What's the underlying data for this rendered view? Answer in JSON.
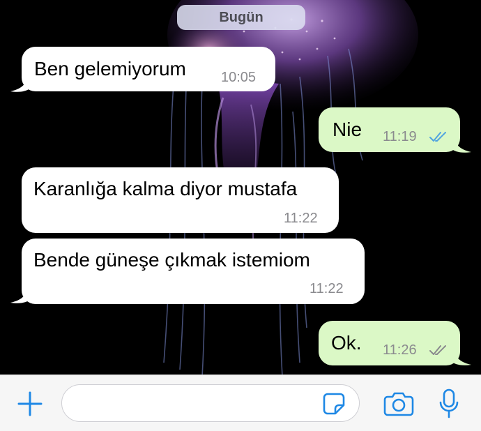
{
  "date_chip": "Bugün",
  "messages": [
    {
      "direction": "incoming",
      "text": "Ben gelemiyorum",
      "time": "10:05"
    },
    {
      "direction": "outgoing",
      "text": "Nie",
      "time": "11:19",
      "status": "read"
    },
    {
      "direction": "incoming",
      "text": "Karanlığa kalma diyor mustafa",
      "time": "11:22"
    },
    {
      "direction": "incoming",
      "text": "Bende güneşe çıkmak istemiom",
      "time": "11:22"
    },
    {
      "direction": "outgoing",
      "text": "Ok.",
      "time": "11:26",
      "status": "delivered"
    }
  ],
  "input": {
    "value": "",
    "placeholder": ""
  },
  "icons": {
    "attach": "plus-icon",
    "sticker": "sticker-icon",
    "camera": "camera-icon",
    "mic": "microphone-icon"
  },
  "colors": {
    "incoming_bubble": "#ffffff",
    "outgoing_bubble": "#dbf8c6",
    "accent": "#1e88e5",
    "read_ticks": "#4fa3e0",
    "delivered_ticks": "#8a8a8e"
  }
}
